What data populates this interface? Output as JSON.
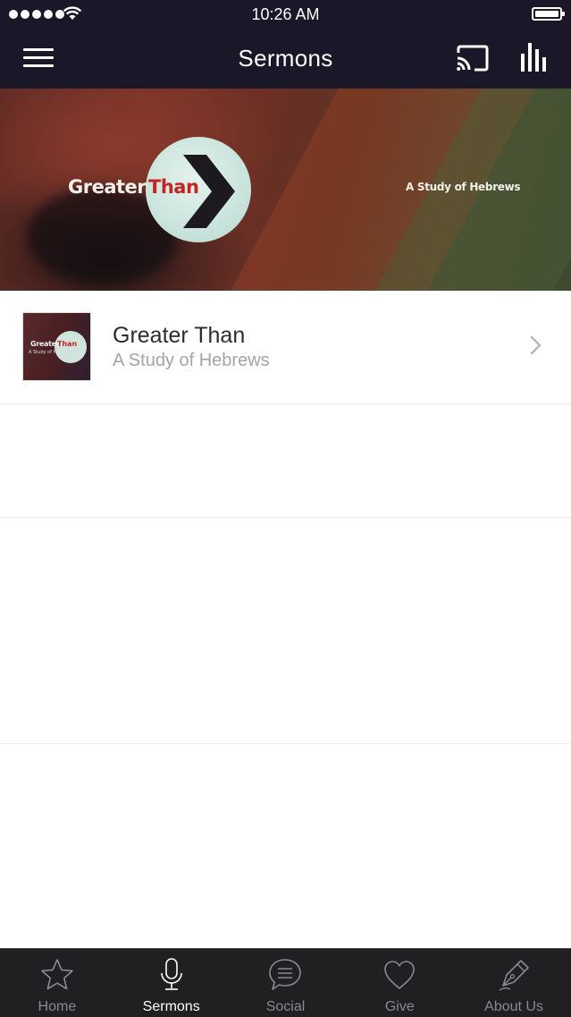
{
  "status_bar": {
    "time": "10:26 AM"
  },
  "header": {
    "title": "Sermons"
  },
  "banner": {
    "title_word1": "Greater",
    "title_word2": "Than",
    "subtitle": "A Study of Hebrews"
  },
  "sermon_list": [
    {
      "title": "Greater Than",
      "subtitle": "A Study of Hebrews",
      "thumb_word1": "Greater",
      "thumb_word2": "Than",
      "thumb_sub": "A Study of Hebrews"
    }
  ],
  "tabs": [
    {
      "label": "Home",
      "icon": "star-icon",
      "active": false
    },
    {
      "label": "Sermons",
      "icon": "microphone-icon",
      "active": true
    },
    {
      "label": "Social",
      "icon": "chat-bubble-icon",
      "active": false
    },
    {
      "label": "Give",
      "icon": "heart-icon",
      "active": false
    },
    {
      "label": "About Us",
      "icon": "pen-nib-icon",
      "active": false
    }
  ],
  "colors": {
    "nav_background": "#1a1728",
    "tab_background": "#201f22",
    "accent_red": "#c32624"
  }
}
